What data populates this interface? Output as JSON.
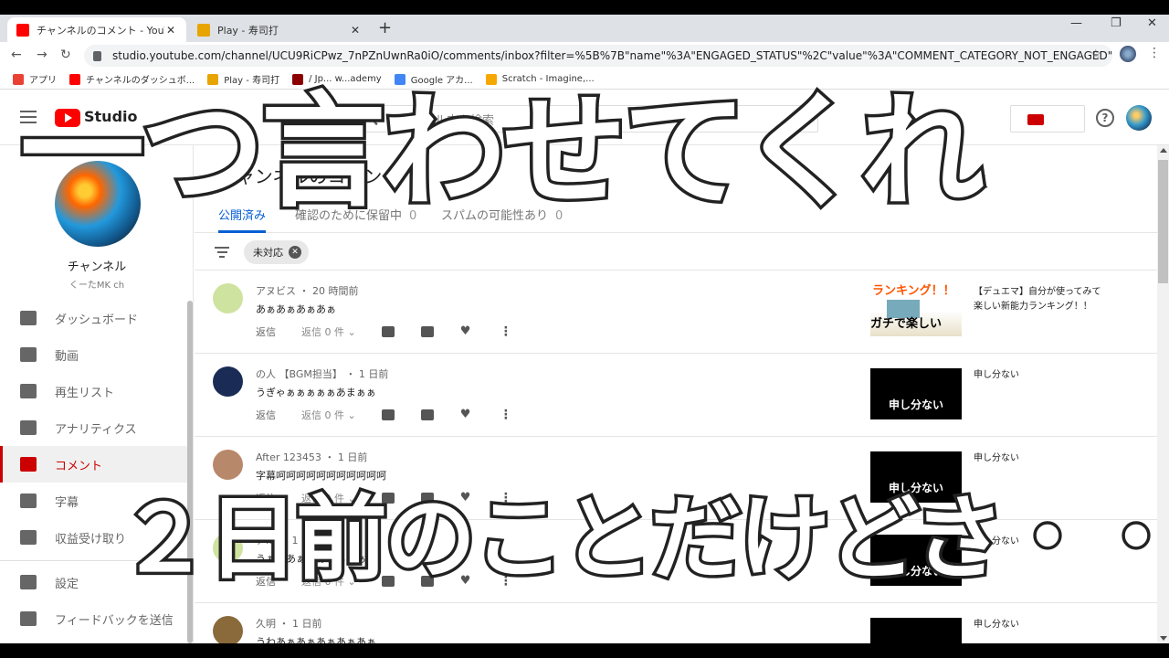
{
  "browser": {
    "tabs": [
      {
        "title": "チャンネルのコメント - YouTube Studio",
        "close": "✕"
      },
      {
        "title": "Play - 寿司打",
        "close": "✕"
      }
    ],
    "new_tab": "+",
    "window_controls": {
      "minimize": "—",
      "maximize": "❐",
      "close": "✕"
    },
    "nav": {
      "back": "←",
      "forward": "→",
      "reload": "↻"
    },
    "url": "studio.youtube.com/channel/UCU9RiCPwz_7nPZnUwnRa0iO/comments/inbox?filter=%5B%7B\"name\"%3A\"ENGAGED_STATUS\"%2C\"value\"%3A\"COMMENT_CATEGORY_NOT_ENGAGED\"%7D%5D",
    "star": "☆",
    "menu": "⋮",
    "bookmarks": [
      {
        "label": "アプリ",
        "color": "#e94235"
      },
      {
        "label": "チャンネルのダッシュボ...",
        "color": "#ff0000"
      },
      {
        "label": "Play - 寿司打",
        "color": "#e8a400"
      },
      {
        "label": "/ Jp... w...ademy",
        "color": "#8b0000"
      },
      {
        "label": "Google アカ...",
        "color": "#4285f4"
      },
      {
        "label": "Scratch - Imagine,...",
        "color": "#f7a800"
      }
    ]
  },
  "studio": {
    "logo_text": "Studio",
    "search_placeholder": "チャンネル内を検索",
    "search_icon": "🔍",
    "help": "?"
  },
  "sidebar": {
    "channel_name": "チャンネル",
    "channel_handle": "くーたMK ch",
    "items": [
      {
        "label": "ダッシュボード",
        "icon": "dashboard-icon"
      },
      {
        "label": "動画",
        "icon": "video-icon"
      },
      {
        "label": "再生リスト",
        "icon": "playlist-icon"
      },
      {
        "label": "アナリティクス",
        "icon": "analytics-icon"
      },
      {
        "label": "コメント",
        "icon": "comment-icon",
        "active": true
      },
      {
        "label": "字幕",
        "icon": "subtitles-icon"
      },
      {
        "label": "収益受け取り",
        "icon": "dollar-icon"
      },
      {
        "label": "設定",
        "icon": "gear-icon"
      },
      {
        "label": "フィードバックを送信",
        "icon": "feedback-icon"
      }
    ],
    "accent": "#cc0000"
  },
  "main": {
    "title": "チャンネルのコメント",
    "tabs": [
      {
        "label": "公開済み",
        "count": ""
      },
      {
        "label": "確認のために保留中",
        "count": "0"
      },
      {
        "label": "スパムの可能性あり",
        "count": "0"
      }
    ],
    "filter_chip": "未対応",
    "chip_close": "✕",
    "comments": [
      {
        "author": "アヌビス ・ 20 時間前",
        "text": "あぁあぁあぁあぁ",
        "reply": "返信",
        "replies": "返信 0 件 ⌄",
        "thumb_text": "ランキング！！",
        "thumb_sub": "ガチで楽しい",
        "video_title": "【デュエマ】自分が使ってみて楽しい新能力ランキング！！",
        "avatar": "#cfe3a0"
      },
      {
        "author": "の人 【BGM担当】 ・ 1 日前",
        "text": "うぎゃぁぁぁぁぁあまぁぁ",
        "reply": "返信",
        "replies": "返信 0 件 ⌄",
        "thumb_text": "申し分ない",
        "video_title": "申し分ない",
        "avatar": "#1a2b55"
      },
      {
        "author": "After 123453 ・ 1 日前",
        "text": "字幕呵呵呵呵呵呵呵呵呵呵呵",
        "reply": "返信",
        "replies": "返信 0 件 ⌄",
        "thumb_text": "申し分ない",
        "video_title": "申し分ない",
        "avatar": "#b8886a"
      },
      {
        "author": "ア... ・ 1 日前",
        "text": "うぁぁあぁぁあぁぁあぁぁ",
        "reply": "返信",
        "replies": "返信 0 件 ⌄",
        "thumb_text": "申し分ない",
        "video_title": "申し分ない",
        "avatar": "#cfe3a0"
      },
      {
        "author": "久明 ・ 1 日前",
        "text": "うわあぁあぁあぁあぁあぁ",
        "reply": "返信",
        "replies": "返信 0 件 ⌄",
        "thumb_text": "",
        "video_title": "申し分ない",
        "avatar": "#8a6a3a"
      }
    ]
  },
  "overlay": {
    "caption_top": "一つ言わせてくれ",
    "caption_bottom": "２日前のことだけどさ・・・"
  }
}
